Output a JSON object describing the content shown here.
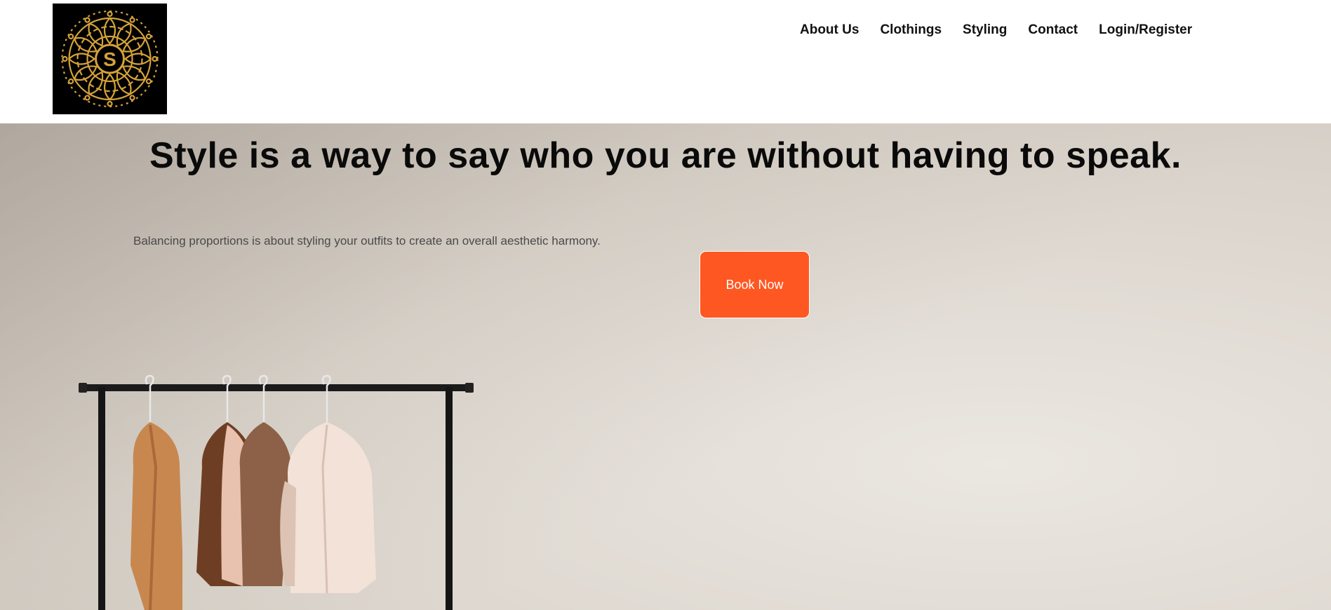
{
  "header": {
    "logo_letter": "S",
    "nav": [
      {
        "label": "About Us"
      },
      {
        "label": "Clothings"
      },
      {
        "label": "Styling"
      },
      {
        "label": "Contact"
      },
      {
        "label": "Login/Register"
      }
    ]
  },
  "hero": {
    "headline": "Style is a way to say who you are without having to speak.",
    "subtext": "Balancing proportions is about styling your outfits to create an overall aesthetic harmony.",
    "cta_label": "Book Now"
  },
  "colors": {
    "cta": "#ff5722",
    "logo_gold": "#d4a23a",
    "logo_bg": "#000000"
  }
}
